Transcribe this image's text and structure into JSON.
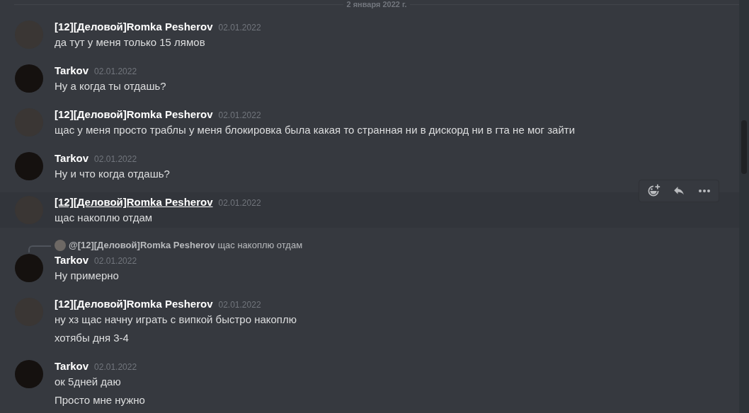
{
  "date_divider": "2 января 2022 г.",
  "messages": [
    {
      "author": "[12][Деловой]Romka Pesherov",
      "kind": "romka",
      "time": "02.01.2022",
      "hovered": false,
      "lines": [
        "да тут у меня только 15 лямов"
      ]
    },
    {
      "author": "Tarkov",
      "kind": "tarkov",
      "time": "02.01.2022",
      "hovered": false,
      "lines": [
        "Ну а когда ты отдашь?"
      ]
    },
    {
      "author": "[12][Деловой]Romka Pesherov",
      "kind": "romka",
      "time": "02.01.2022",
      "hovered": false,
      "lines": [
        "щас у меня просто траблы у меня блокировка была какая то странная ни в дискорд ни в гта не мог зайти"
      ]
    },
    {
      "author": "Tarkov",
      "kind": "tarkov",
      "time": "02.01.2022",
      "hovered": false,
      "lines": [
        "Ну и что когда отдашь?"
      ]
    },
    {
      "author": "[12][Деловой]Romka Pesherov",
      "kind": "romka",
      "time": "02.01.2022",
      "hovered": true,
      "lines": [
        "щас накоплю отдам"
      ]
    },
    {
      "author": "Tarkov",
      "kind": "tarkov",
      "time": "02.01.2022",
      "hovered": false,
      "reply": {
        "author": "@[12][Деловой]Romka Pesherov",
        "text": "щас накоплю отдам",
        "kind": "romka"
      },
      "lines": [
        "Ну примерно"
      ]
    },
    {
      "author": "[12][Деловой]Romka Pesherov",
      "kind": "romka",
      "time": "02.01.2022",
      "hovered": false,
      "lines": [
        "ну хз щас начну играть с випкой быстро накоплю",
        "хотябы дня 3-4"
      ]
    },
    {
      "author": "Tarkov",
      "kind": "tarkov",
      "time": "02.01.2022",
      "hovered": false,
      "lines": [
        "ок 5дней даю",
        "Просто мне нужно"
      ]
    }
  ]
}
